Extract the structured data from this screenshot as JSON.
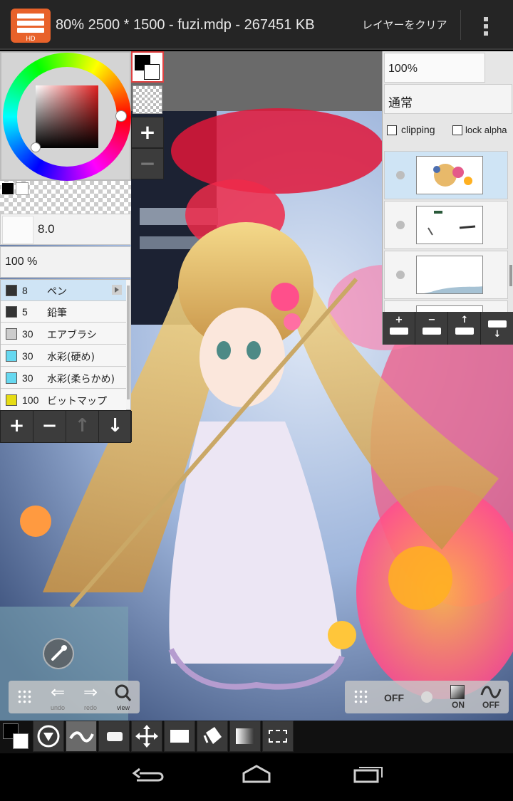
{
  "app": {
    "icon_label": "HD",
    "title": "80% 2500 * 1500 - fuzi.mdp - 267451 KB",
    "clear_layer_label": "レイヤーをクリア"
  },
  "brush": {
    "size": "8.0",
    "opacity": "100 %",
    "items": [
      {
        "size": "8",
        "name": "ペン",
        "color": "#333333",
        "selected": true
      },
      {
        "size": "5",
        "name": "鉛筆",
        "color": "#333333"
      },
      {
        "size": "30",
        "name": "エアブラシ",
        "color": "#cccccc"
      },
      {
        "size": "30",
        "name": "水彩(硬め)",
        "color": "#66d8f0"
      },
      {
        "size": "30",
        "name": "水彩(柔らかめ)",
        "color": "#66d8f0"
      },
      {
        "size": "100",
        "name": "ビットマップ",
        "color": "#e6dc14"
      }
    ],
    "actions": [
      "+",
      "−",
      "↑",
      "↓"
    ]
  },
  "layer": {
    "opacity": "100%",
    "blend_mode": "通常",
    "clipping_label": "clipping",
    "lock_alpha_label": "lock alpha"
  },
  "canvas_tools": {
    "undo_label": "undo",
    "redo_label": "redo",
    "view_label": "view",
    "off_label_1": "OFF",
    "on_label": "ON",
    "off_label_2": "OFF"
  },
  "colors": {
    "accent": "#e8622a",
    "panel": "#e6e6e6",
    "selected_row": "#cfe4f5",
    "toolbar": "#3c3c3c"
  },
  "icons": [
    "menu-icon",
    "overflow-icon",
    "eyedropper-icon",
    "undo-icon",
    "redo-icon",
    "magnifier-icon",
    "back-icon",
    "home-icon",
    "recents-icon"
  ]
}
